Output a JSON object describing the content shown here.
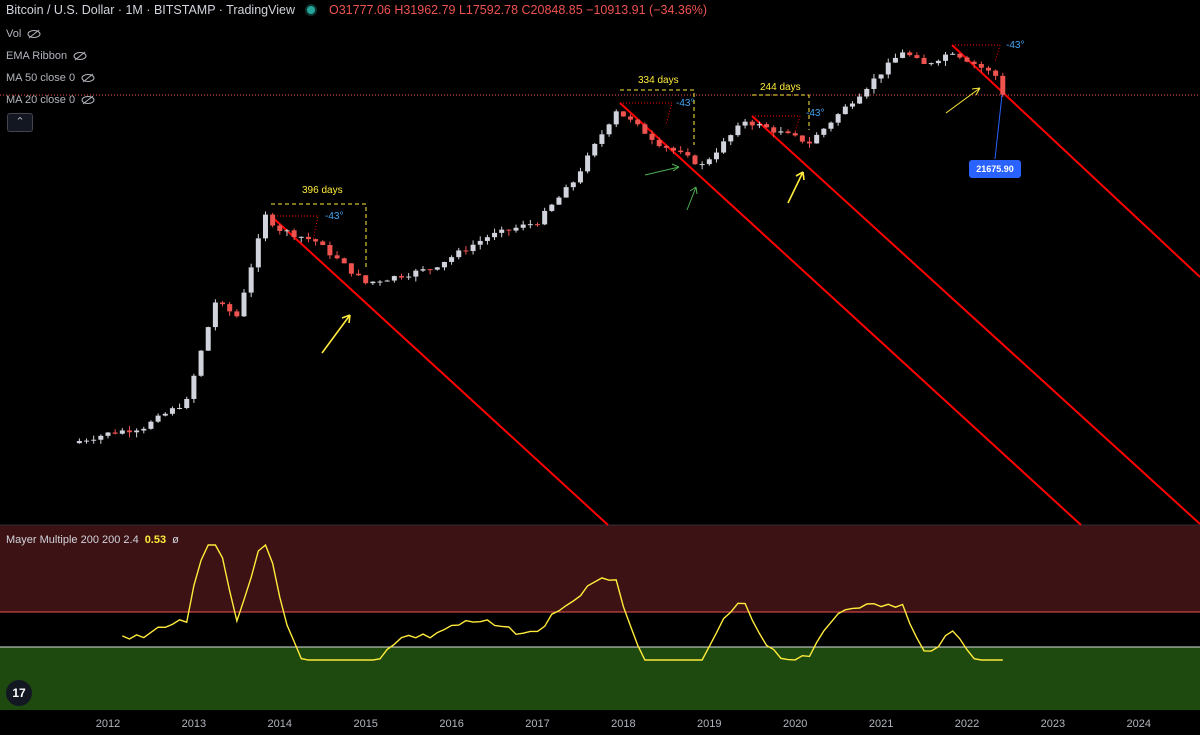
{
  "header": {
    "title": "Bitcoin / U.S. Dollar · 1M · BITSTAMP · TradingView",
    "ohlc": "O31777.06 H31962.79 L17592.78 C20848.85 −10913.91 (−34.36%)"
  },
  "indicators": [
    {
      "label": "Vol"
    },
    {
      "label": "EMA Ribbon"
    },
    {
      "label": "MA 50 close 0"
    },
    {
      "label": "MA 20 close 0"
    }
  ],
  "collapse_icon": "chevron-up",
  "price_label": "21675.90",
  "annotations": {
    "days": [
      "396 days",
      "334 days",
      "244 days"
    ],
    "angles": [
      "-43°",
      "-43°",
      "-43°",
      "-43°"
    ]
  },
  "lower_pane": {
    "label": "Mayer Multiple 200 200 2.4",
    "value": "0.53",
    "suffix": "ø"
  },
  "colors": {
    "up": "#d1d4dc",
    "down": "#ef5350",
    "trend": "#ff0000",
    "overbought_bg": "#3d1214",
    "oversold_bg": "#1e4a0f",
    "mayer_line": "#ffeb3b"
  },
  "chart_data": {
    "type": "line",
    "x_ticks": [
      "2012",
      "2013",
      "2014",
      "2015",
      "2016",
      "2017",
      "2018",
      "2019",
      "2020",
      "2021",
      "2022",
      "2023",
      "2024"
    ],
    "y_scale": "log",
    "price_series": {
      "name": "Bitcoin / U.S. Dollar",
      "approx_monthly_close": [
        {
          "x": "2011-09",
          "y": 5
        },
        {
          "x": "2012-01",
          "y": 6
        },
        {
          "x": "2012-06",
          "y": 7
        },
        {
          "x": "2012-12",
          "y": 13
        },
        {
          "x": "2013-04",
          "y": 140
        },
        {
          "x": "2013-07",
          "y": 100
        },
        {
          "x": "2013-11",
          "y": 1100
        },
        {
          "x": "2014-01",
          "y": 800
        },
        {
          "x": "2014-06",
          "y": 600
        },
        {
          "x": "2015-01",
          "y": 220
        },
        {
          "x": "2015-10",
          "y": 310
        },
        {
          "x": "2016-06",
          "y": 670
        },
        {
          "x": "2017-01",
          "y": 960
        },
        {
          "x": "2017-06",
          "y": 2500
        },
        {
          "x": "2017-12",
          "y": 14000
        },
        {
          "x": "2018-06",
          "y": 6300
        },
        {
          "x": "2018-12",
          "y": 3700
        },
        {
          "x": "2019-06",
          "y": 10800
        },
        {
          "x": "2020-03",
          "y": 6400
        },
        {
          "x": "2020-12",
          "y": 29000
        },
        {
          "x": "2021-04",
          "y": 57000
        },
        {
          "x": "2021-07",
          "y": 41000
        },
        {
          "x": "2021-11",
          "y": 57000
        },
        {
          "x": "2022-05",
          "y": 31800
        },
        {
          "x": "2022-06",
          "y": 20848.85
        }
      ]
    },
    "mayer_multiple": {
      "name": "Mayer Multiple 200 200 2.4",
      "last_value": 0.53,
      "thresholds": [
        2.4,
        1.0
      ]
    }
  }
}
